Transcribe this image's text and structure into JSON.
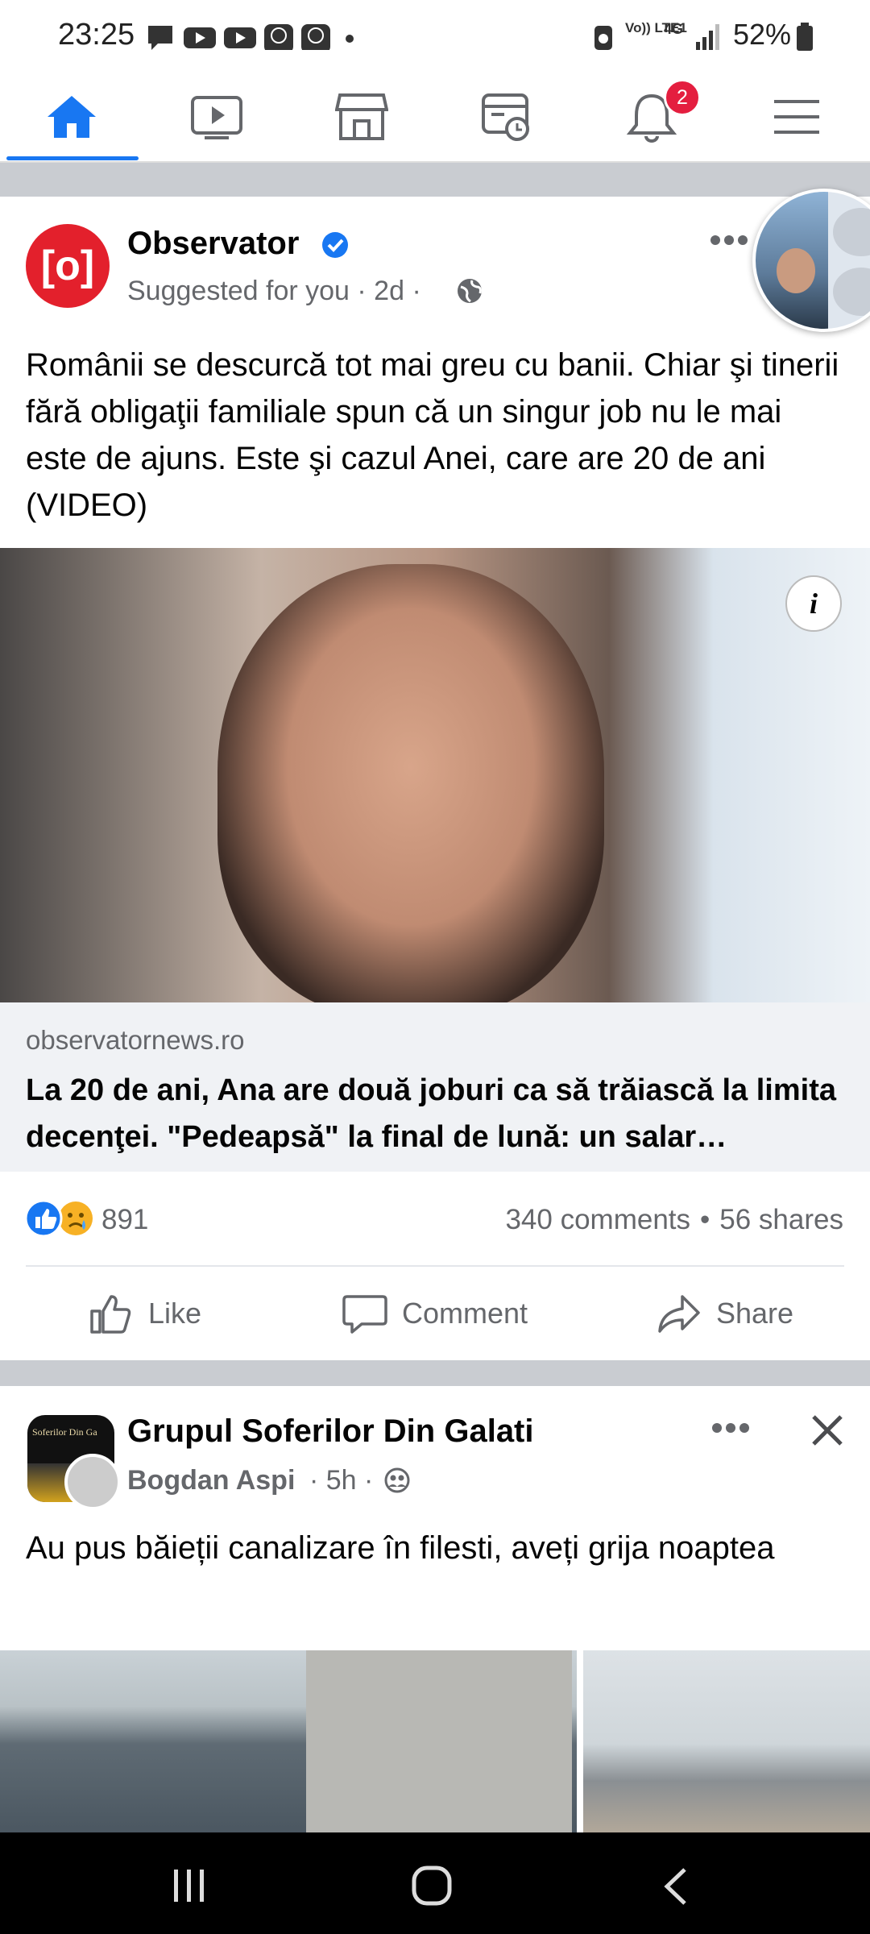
{
  "status_bar": {
    "time": "23:25",
    "signal_labels": {
      "volte": "Vo)) LTE1",
      "network": "4G"
    },
    "battery": "52%"
  },
  "nav": {
    "notification_badge": "2",
    "tabs": [
      "home-icon",
      "watch-icon",
      "marketplace-icon",
      "memories-icon",
      "notifications-icon",
      "menu-icon"
    ],
    "accent_color": "#1877f2"
  },
  "post1": {
    "page_name": "Observator",
    "meta": "Suggested for you · 2d ·",
    "text": "Românii se descurcă tot mai greu cu banii. Chiar şi tinerii fără obligaţii familiale spun că un singur job nu le mai este de ajuns. Este şi cazul Anei, care are 20 de ani (VIDEO)",
    "link_domain": "observatornews.ro",
    "link_title": "La 20 de ani, Ana are două joburi ca să trăiască la limita decenţei. \"Pedeapsă\" la final de lună: un salar…",
    "reactions_count": "891",
    "comments": "340 comments",
    "shares": "56 shares",
    "separator": "•",
    "actions": {
      "like": "Like",
      "comment": "Comment",
      "share": "Share"
    }
  },
  "post2": {
    "group_name": "Grupul Soferilor Din Galati",
    "author": "Bogdan Aspi",
    "meta": "· 5h ·",
    "text": "Au pus băieții canalizare în filesti, aveți grija noaptea"
  }
}
